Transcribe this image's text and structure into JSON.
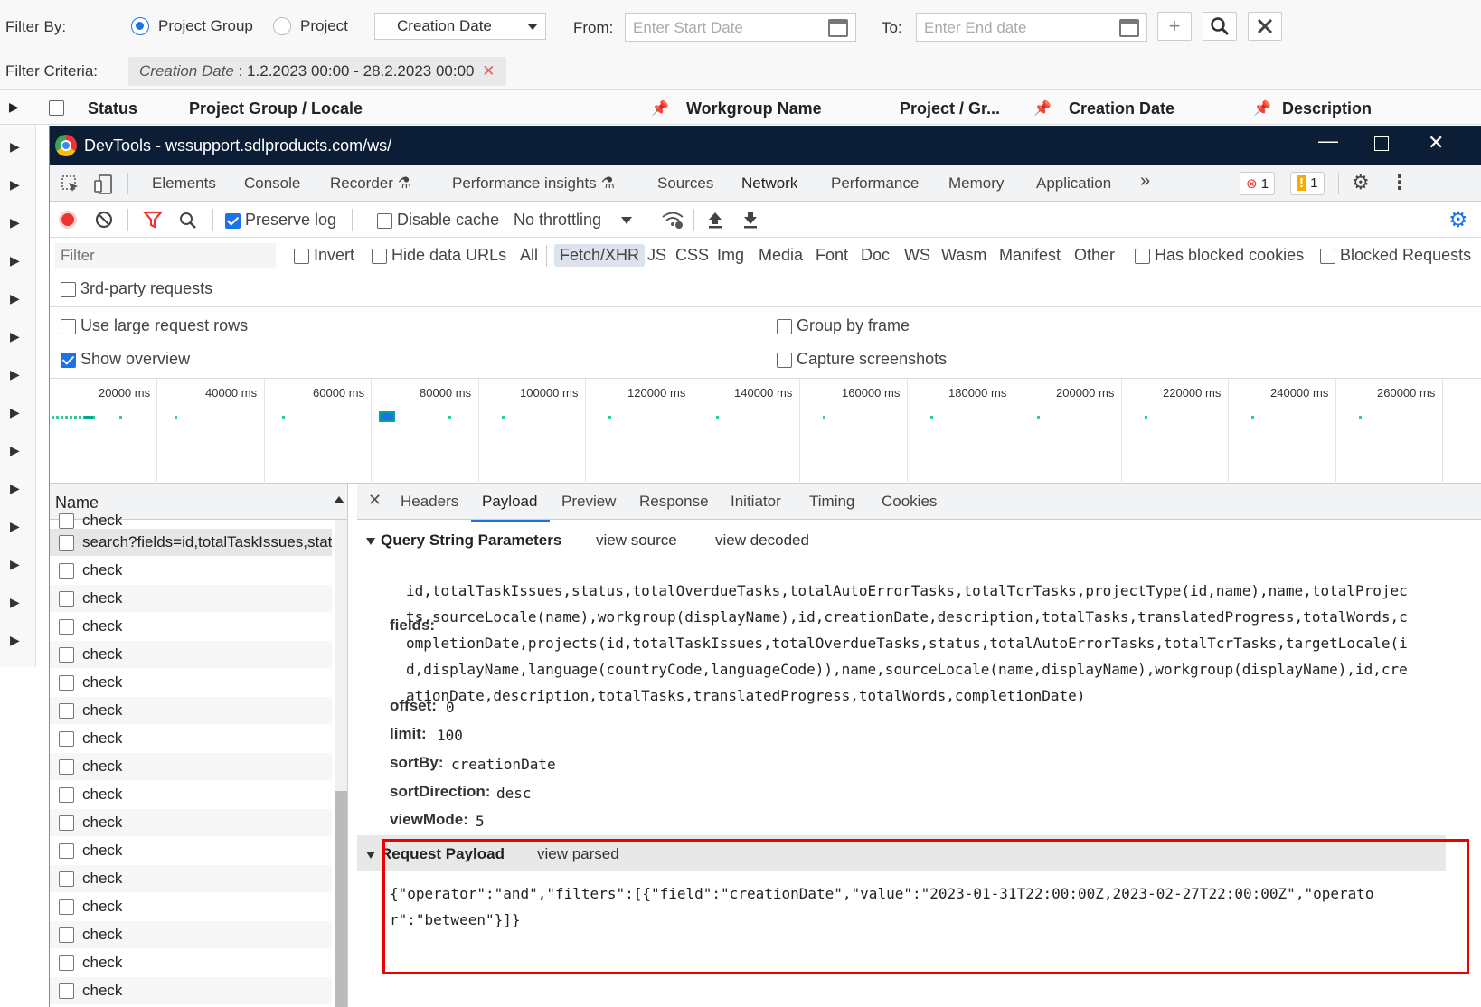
{
  "app": {
    "filter_by_label": "Filter By:",
    "radio_project_group": "Project Group",
    "radio_project": "Project",
    "date_type": "Creation Date",
    "from_label": "From:",
    "from_placeholder": "Enter Start Date",
    "to_label": "To:",
    "to_placeholder": "Enter End date",
    "filter_criteria_label": "Filter Criteria:",
    "criteria_key": "Creation Date",
    "criteria_value": ": 1.2.2023 00:00 - 28.2.2023 00:00",
    "columns": [
      "Status",
      "Project Group / Locale",
      "Workgroup Name",
      "Project / Gr...",
      "Creation Date",
      "Description"
    ]
  },
  "devtools": {
    "title": "DevTools - wssupport.sdlproducts.com/ws/",
    "tabs": [
      "Elements",
      "Console",
      "Recorder",
      "Performance insights",
      "Sources",
      "Network",
      "Performance",
      "Memory",
      "Application"
    ],
    "active_tab": "Network",
    "error_count": "1",
    "warning_count": "1",
    "toolbar": {
      "preserve_log": "Preserve log",
      "disable_cache": "Disable cache",
      "throttling": "No throttling"
    },
    "filter_placeholder": "Filter",
    "invert": "Invert",
    "hide_data_urls": "Hide data URLs",
    "types": [
      "All",
      "Fetch/XHR",
      "JS",
      "CSS",
      "Img",
      "Media",
      "Font",
      "Doc",
      "WS",
      "Wasm",
      "Manifest",
      "Other"
    ],
    "has_blocked_cookies": "Has blocked cookies",
    "blocked_requests": "Blocked Requests",
    "third_party": "3rd-party requests",
    "settings": {
      "large_rows": "Use large request rows",
      "group_by_frame": "Group by frame",
      "show_overview": "Show overview",
      "capture_screenshots": "Capture screenshots"
    },
    "timeline_ticks": [
      "20000 ms",
      "40000 ms",
      "60000 ms",
      "80000 ms",
      "100000 ms",
      "120000 ms",
      "140000 ms",
      "160000 ms",
      "180000 ms",
      "200000 ms",
      "220000 ms",
      "240000 ms",
      "260000 ms"
    ],
    "name_header": "Name",
    "requests": [
      "check",
      "search?fields=id,totalTaskIssues,statu",
      "check",
      "check",
      "check",
      "check",
      "check",
      "check",
      "check",
      "check",
      "check",
      "check",
      "check",
      "check",
      "check",
      "check",
      "check",
      "check"
    ],
    "detail_tabs": [
      "Headers",
      "Payload",
      "Preview",
      "Response",
      "Initiator",
      "Timing",
      "Cookies"
    ],
    "active_detail_tab": "Payload",
    "query_section": "Query String Parameters",
    "view_source": "view source",
    "view_decoded": "view decoded",
    "params": {
      "fields_key": "fields:",
      "fields_value": "id,totalTaskIssues,status,totalOverdueTasks,totalAutoErrorTasks,totalTcrTasks,projectType(id,name),name,totalProjects,sourceLocale(name),workgroup(displayName),id,creationDate,description,totalTasks,translatedProgress,totalWords,completionDate,projects(id,totalTaskIssues,totalOverdueTasks,status,totalAutoErrorTasks,totalTcrTasks,targetLocale(id,displayName,language(countryCode,languageCode)),name,sourceLocale(name,displayName),workgroup(displayName),id,creationDate,description,totalTasks,translatedProgress,totalWords,completionDate)",
      "offset_key": "offset:",
      "offset_value": "0",
      "limit_key": "limit:",
      "limit_value": "100",
      "sortby_key": "sortBy:",
      "sortby_value": "creationDate",
      "sortdir_key": "sortDirection:",
      "sortdir_value": "desc",
      "viewmode_key": "viewMode:",
      "viewmode_value": "5"
    },
    "payload_section": "Request Payload",
    "view_parsed": "view parsed",
    "payload": "{\"operator\":\"and\",\"filters\":[{\"field\":\"creationDate\",\"value\":\"2023-01-31T22:00:00Z,2023-02-27T22:00:00Z\",\"operator\":\"between\"}]}"
  }
}
